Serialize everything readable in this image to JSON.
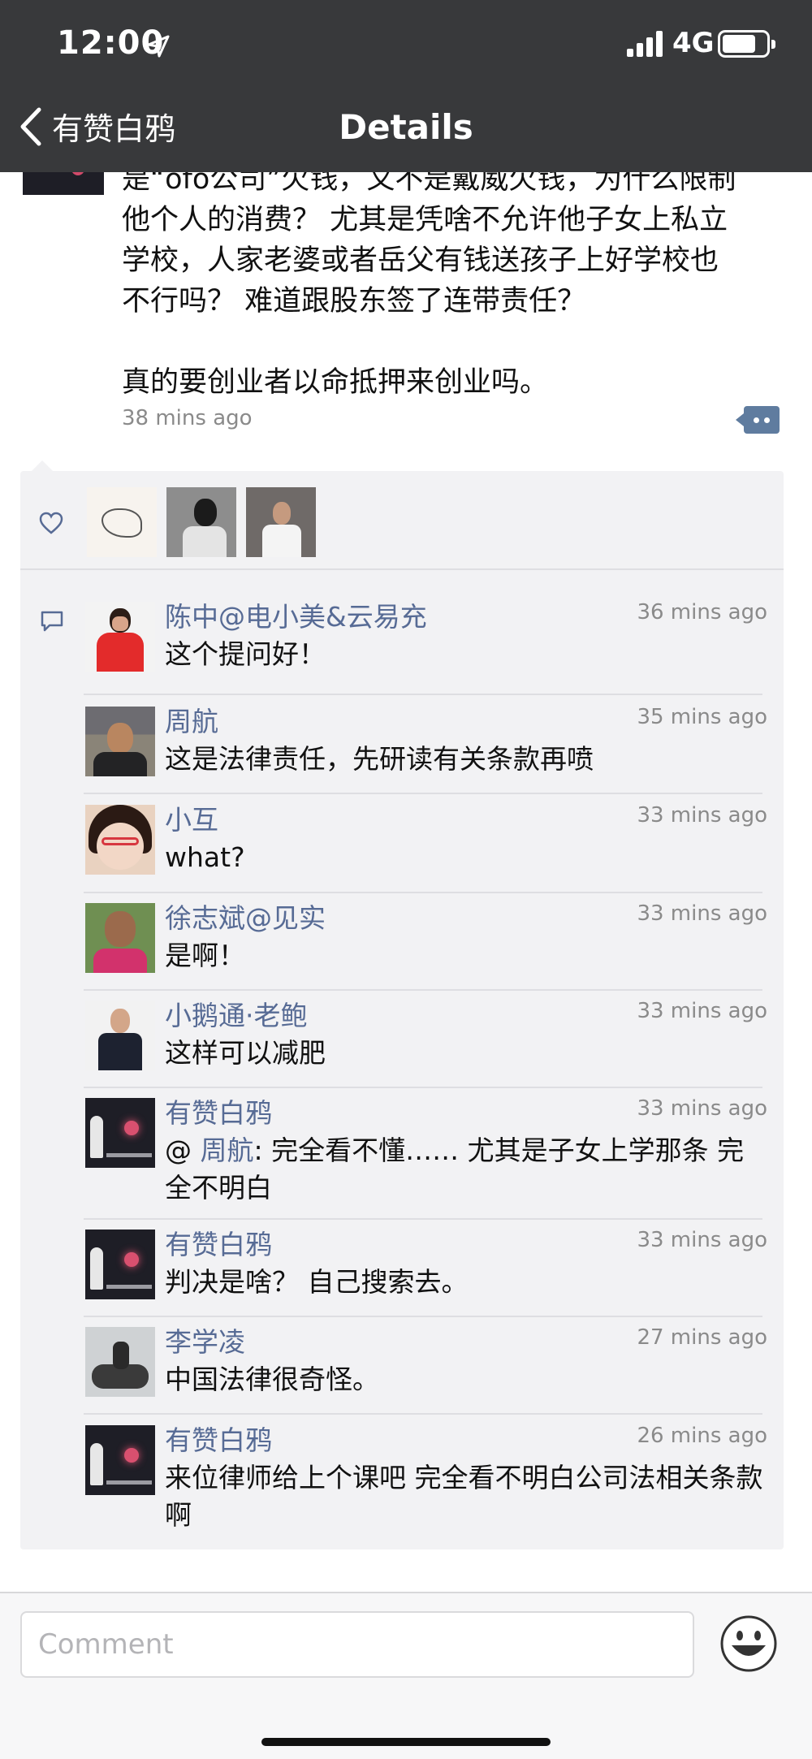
{
  "status_bar": {
    "time": "12:00",
    "network": "4G"
  },
  "nav": {
    "back_label": "有赞白鸦",
    "title": "Details"
  },
  "post": {
    "lines": [
      "是“ofo公司”欠钱，又不是戴威欠钱，为什么限制",
      "他个人的消费？ 尤其是凭啥不允许他子女上私立",
      "学校，人家老婆或者岳父有钱送孩子上好学校也",
      "不行吗？ 难道跟股东签了连带责任？"
    ],
    "closing": "真的要创业者以命抵押来创业吗。",
    "time": "38 mins ago"
  },
  "comments": [
    {
      "name": "陈中@电小美&云易充",
      "time": "36 mins ago",
      "text": "这个提问好！"
    },
    {
      "name": "周航",
      "time": "35 mins ago",
      "text": "这是法律责任，先研读有关条款再喷"
    },
    {
      "name": "小互",
      "time": "33 mins ago",
      "text": "what?"
    },
    {
      "name": "徐志斌@见实",
      "time": "33 mins ago",
      "text": "是啊！"
    },
    {
      "name": "小鹅通·老鲍",
      "time": "33 mins ago",
      "text": "这样可以减肥"
    },
    {
      "name": "有赞白鸦",
      "time": "33 mins ago",
      "mention_prefix": "@ ",
      "mention": "周航",
      "text": ": 完全看不懂…… 尤其是子女上学那条 完全不明白"
    },
    {
      "name": "有赞白鸦",
      "time": "33 mins ago",
      "text": "判决是啥？  自己搜索去。"
    },
    {
      "name": "李学凌",
      "time": "27 mins ago",
      "text": "中国法律很奇怪。"
    },
    {
      "name": "有赞白鸦",
      "time": "26 mins ago",
      "text": "来位律师给上个课吧 完全看不明白公司法相关条款啊"
    }
  ],
  "input": {
    "placeholder": "Comment"
  },
  "colors": {
    "nav_bg": "#38393b",
    "link_blue": "#576b95",
    "panel_bg": "#f2f2f4"
  },
  "icons": [
    "location-arrow-icon",
    "signal-icon",
    "battery-icon",
    "back-chevron-icon",
    "more-dots-icon",
    "heart-icon",
    "comment-bubble-icon",
    "emoji-icon"
  ]
}
